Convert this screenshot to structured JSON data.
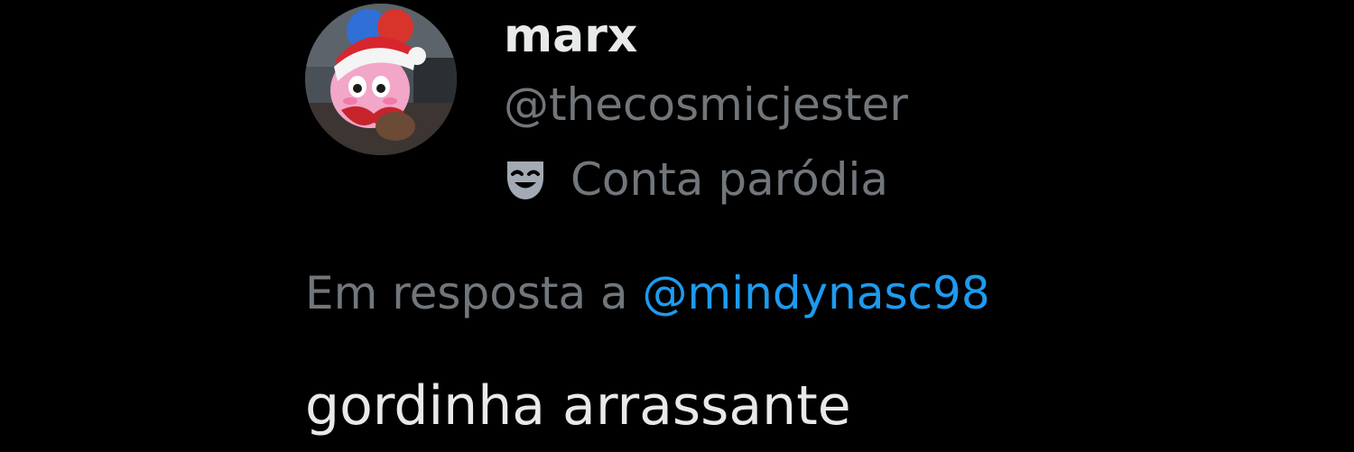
{
  "tweet": {
    "author": {
      "display_name": "marx",
      "handle": "@thecosmicjester",
      "avatar_icon": "pink-plush-avatar-icon"
    },
    "label": {
      "icon": "theater-mask-icon",
      "text": "Conta paródia"
    },
    "reply_context": {
      "prefix": "Em resposta a",
      "mention": "@mindynasc98"
    },
    "text": "gordinha arrassante"
  },
  "colors": {
    "background": "#000000",
    "primary_text": "#e7e9ea",
    "secondary_text": "#71767b",
    "link": "#1d9bf0"
  }
}
